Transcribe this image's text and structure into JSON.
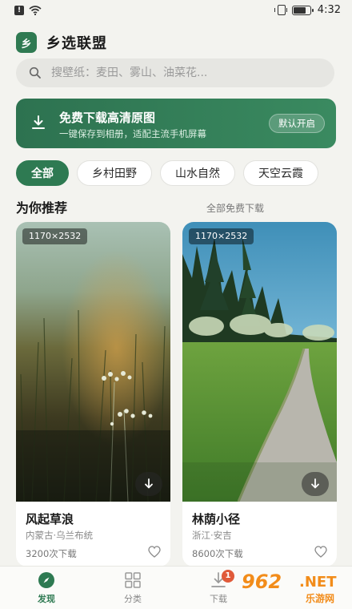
{
  "status_bar": {
    "time": "4:32",
    "battery_level": 0.8
  },
  "header": {
    "logo_glyph": "乡",
    "title": "乡选联盟"
  },
  "search": {
    "placeholder": "搜壁纸：麦田、雾山、油菜花..."
  },
  "banner": {
    "title": "免费下载高清原图",
    "subtitle": "一键保存到相册，适配主流手机屏幕",
    "button_label": "默认开启"
  },
  "categories": [
    "全部",
    "乡村田野",
    "山水自然",
    "天空云霞"
  ],
  "section": {
    "title": "为你推荐",
    "link": "全部免费下载"
  },
  "cards": [
    {
      "resolution": "1170×2532",
      "title": "风起草浪",
      "location": "内蒙古·乌兰布统",
      "downloads": "3200次下载"
    },
    {
      "resolution": "1170×2532",
      "title": "林荫小径",
      "location": "浙江·安吉",
      "downloads": "8600次下载"
    }
  ],
  "nav": {
    "items": [
      {
        "label": "发现",
        "icon": "compass-icon"
      },
      {
        "label": "分类",
        "icon": "grid-icon"
      },
      {
        "label": "下载",
        "icon": "download-icon",
        "badge": "1"
      }
    ]
  },
  "watermark": {
    "number": "962",
    "net": ".NET",
    "sub": "乐游网"
  },
  "colors": {
    "accent": "#2e7a52",
    "background": "#f3f3ef"
  }
}
